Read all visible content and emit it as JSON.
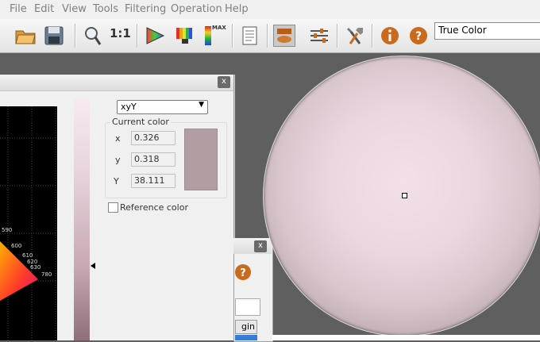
{
  "menu": {
    "items": [
      "File",
      "Edit",
      "View",
      "Tools",
      "Filtering",
      "Operation",
      "Help"
    ]
  },
  "toolbar": {
    "buttons": [
      "open-folder-icon",
      "save-icon",
      "zoom-icon",
      "zoom-1-1-icon",
      "color-triangle-icon",
      "spectrum-icon",
      "max-level-icon",
      "report-icon",
      "image-view-icon",
      "adjust-sliders-icon",
      "tools-icon",
      "info-icon",
      "help-icon"
    ],
    "zoom_label": "1:1",
    "max_label": "MAX",
    "display_mode": "True Color"
  },
  "color_panel": {
    "color_space": "xyY",
    "group_title": "Current color",
    "fields": [
      {
        "label": "x",
        "value": "0.326"
      },
      {
        "label": "y",
        "value": "0.318"
      },
      {
        "label": "Y",
        "value": "38.111"
      }
    ],
    "reference_label": "Reference color",
    "swatch_color": "#b29da3",
    "wavelength_labels": [
      "590",
      "600",
      "610",
      "620",
      "630",
      "780"
    ]
  },
  "win2": {
    "button_partial": "gin"
  },
  "colors": {
    "accent": "#c96a1e",
    "workspace": "#5f5f5f"
  }
}
